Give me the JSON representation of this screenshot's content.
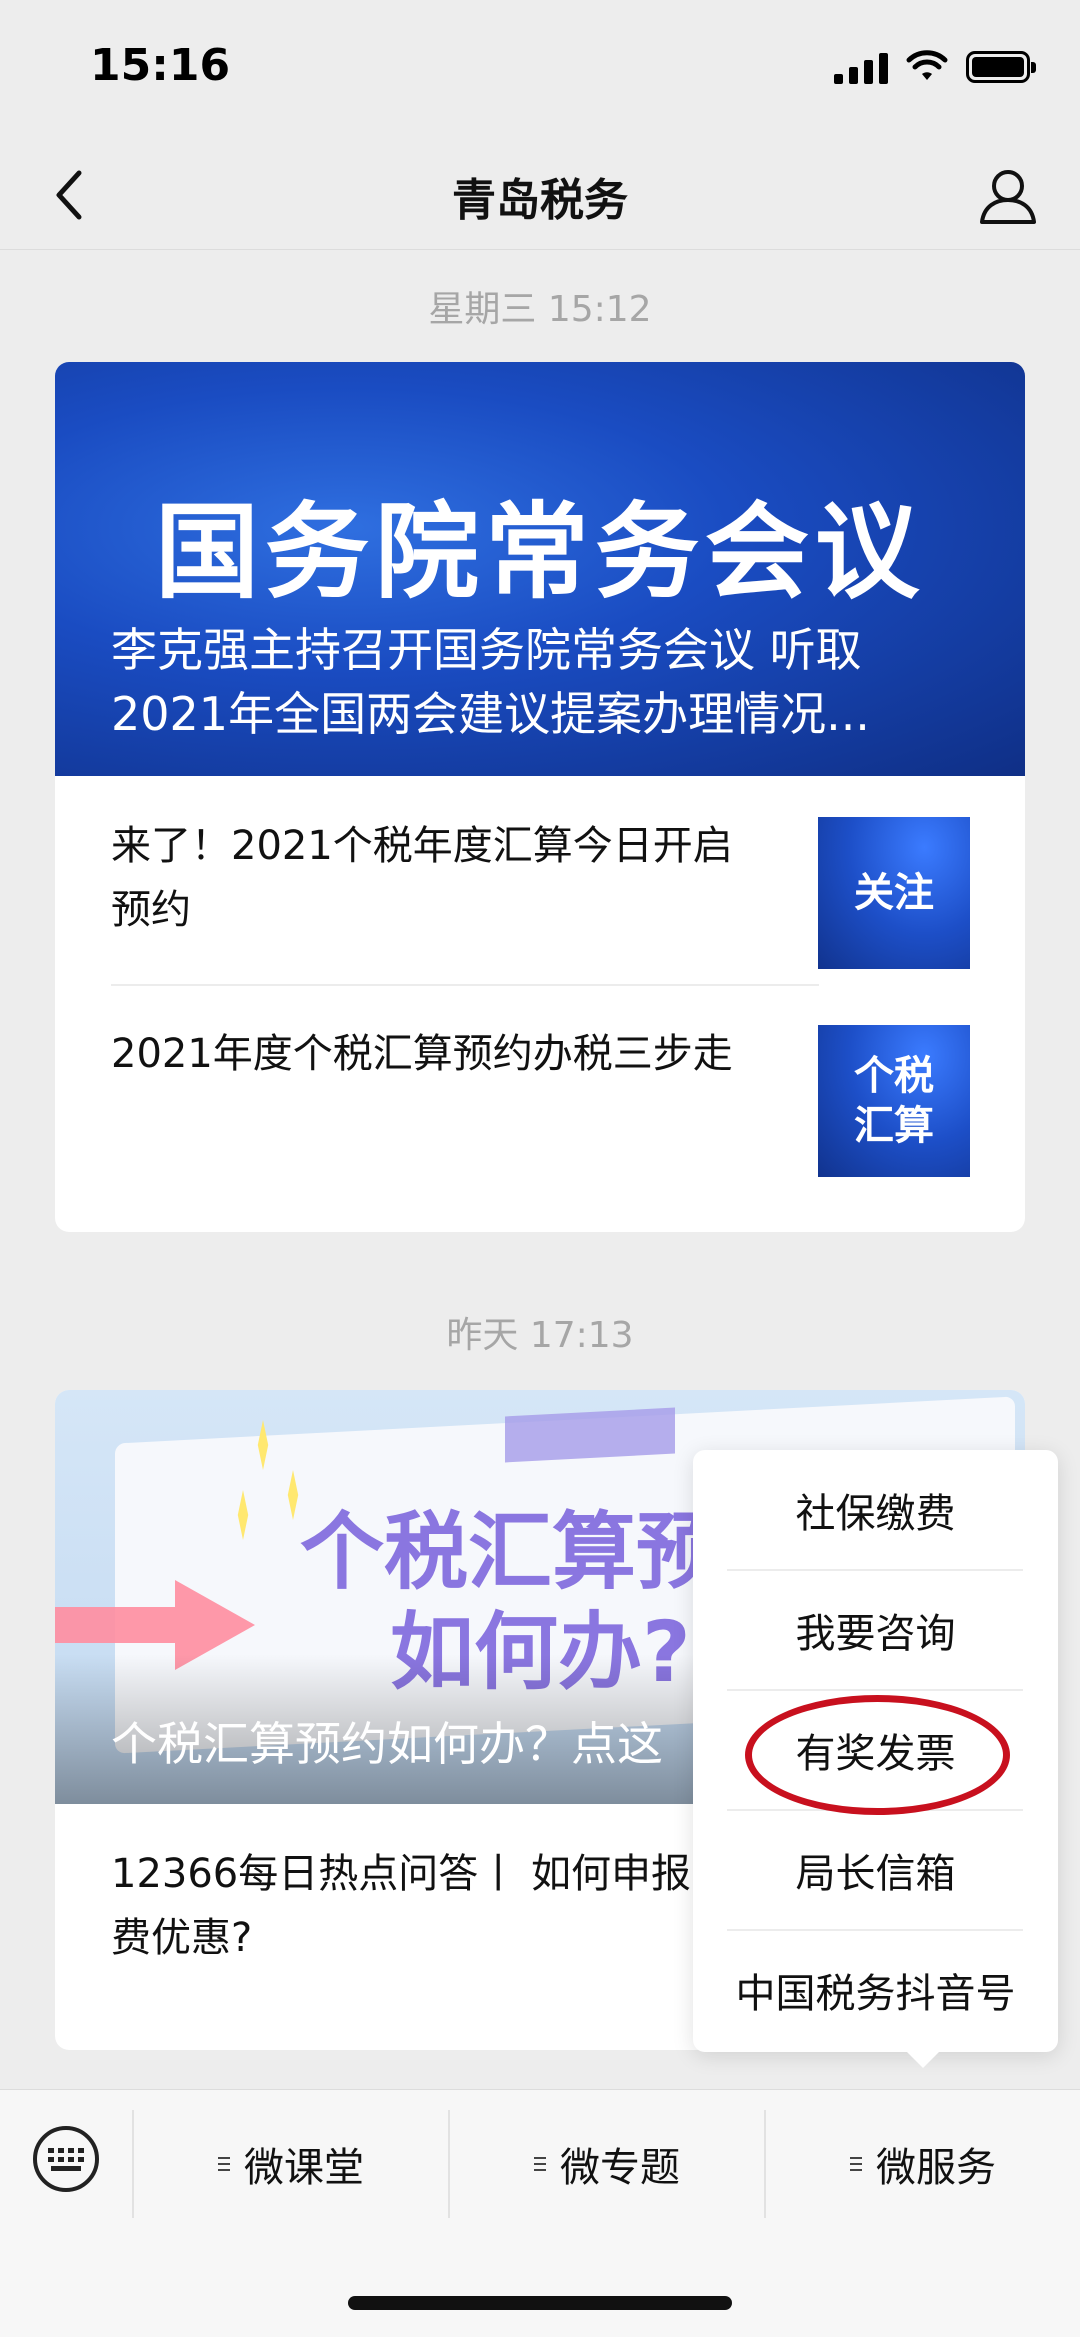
{
  "status_bar": {
    "time": "15:16",
    "icons": [
      "signal-icon",
      "wifi-icon",
      "battery-icon"
    ]
  },
  "nav": {
    "title": "青岛税务",
    "back_icon": "chevron-left-icon",
    "profile_icon": "user-icon"
  },
  "messages": [
    {
      "timestamp": "星期三 15:12",
      "main": {
        "banner_title": "国务院常务会议",
        "caption_line1": "李克强主持召开国务院常务会议 听取",
        "caption_line2": "2021年全国两会建议提案办理情况..."
      },
      "items": [
        {
          "title": "来了！2021个税年度汇算今日开启预约",
          "thumb": "关注"
        },
        {
          "title": "2021年度个税汇算预约办税三步走",
          "thumb_line1": "个税",
          "thumb_line2": "汇算"
        }
      ]
    },
    {
      "timestamp": "昨天 17:13",
      "main": {
        "banner_text_line1": "个税汇算预",
        "banner_text_line2": "如何办?",
        "caption": "个税汇算预约如何办？点这"
      },
      "items": [
        {
          "title": "12366每日热点问答丨 如何申报高校学生公寓税费优惠?"
        }
      ]
    }
  ],
  "popup_menu": {
    "items": [
      "社保缴费",
      "我要咨询",
      "有奖发票",
      "局长信箱",
      "中国税务抖音号"
    ],
    "highlighted_index": 2,
    "highlight_color": "#c8101e"
  },
  "bottom_menu": {
    "keyboard_icon": "keyboard-icon",
    "items": [
      "微课堂",
      "微专题",
      "微服务"
    ]
  }
}
